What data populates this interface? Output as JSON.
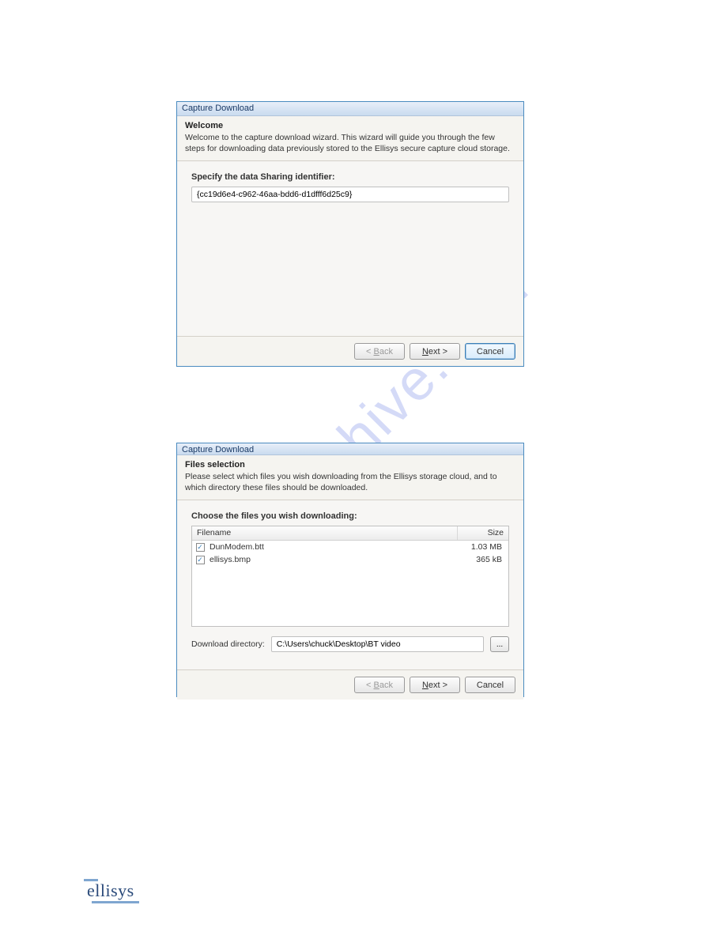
{
  "watermark": "manualshive.com",
  "dialog1": {
    "title": "Capture Download",
    "header_title": "Welcome",
    "header_desc": "Welcome to the capture download wizard.  This wizard will guide you through the few steps for downloading data previously stored to the Ellisys secure capture cloud storage.",
    "identifier_label": "Specify the data Sharing identifier:",
    "identifier_value": "{cc19d6e4-c962-46aa-bdd6-d1dfff6d25c9}",
    "buttons": {
      "back": "< Back",
      "next": "Next >",
      "cancel": "Cancel"
    }
  },
  "dialog2": {
    "title": "Capture Download",
    "header_title": "Files selection",
    "header_desc": "Please select which files you wish downloading from the Ellisys storage cloud, and to which directory these files should be downloaded.",
    "choose_label": "Choose the files you wish downloading:",
    "columns": {
      "filename": "Filename",
      "size": "Size"
    },
    "rows": [
      {
        "checked": true,
        "filename": "DunModem.btt",
        "size": "1.03 MB"
      },
      {
        "checked": true,
        "filename": "ellisys.bmp",
        "size": "365 kB"
      }
    ],
    "download_dir_label": "Download directory:",
    "download_dir_value": "C:\\Users\\chuck\\Desktop\\BT video",
    "browse_label": "...",
    "buttons": {
      "back": "< Back",
      "next": "Next >",
      "cancel": "Cancel"
    }
  },
  "footer": {
    "logo_text": "ellisys"
  }
}
